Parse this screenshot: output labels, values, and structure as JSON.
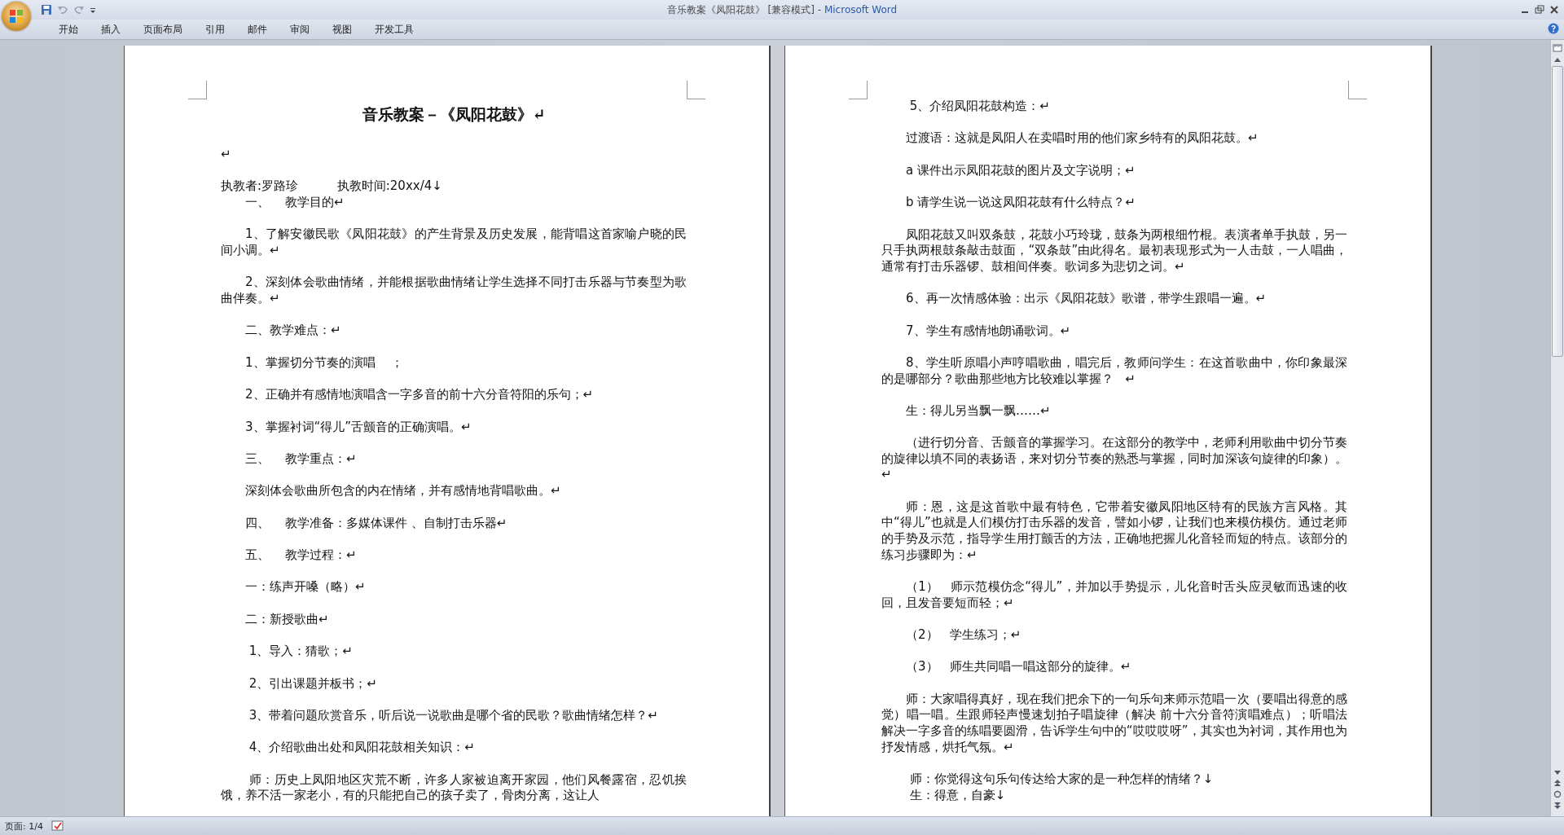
{
  "window": {
    "title_document": "音乐教案《凤阳花鼓》 [兼容模式] - ",
    "title_app": "Microsoft Word"
  },
  "ribbon_tabs": [
    {
      "label": "开始"
    },
    {
      "label": "插入"
    },
    {
      "label": "页面布局"
    },
    {
      "label": "引用"
    },
    {
      "label": "邮件"
    },
    {
      "label": "审阅"
    },
    {
      "label": "视图"
    },
    {
      "label": "开发工具"
    }
  ],
  "pages": [
    {
      "paragraphs": [
        {
          "kind": "title",
          "text": "音乐教案－《凤阳花鼓》↵"
        },
        {
          "kind": "mark",
          "text": "↵"
        },
        {
          "kind": "line",
          "text": "执教者:罗路珍          执教时间:20xx/4↓"
        },
        {
          "kind": "body",
          "text": "一、    教学目的↵"
        },
        {
          "kind": "body",
          "text": "1、了解安徽民歌《凤阳花鼓》的产生背景及历史发展，能背唱这首家喻户晓的民间小调。↵"
        },
        {
          "kind": "body",
          "text": "2、深刻体会歌曲情绪，并能根据歌曲情绪让学生选择不同打击乐器与节奏型为歌曲伴奏。↵"
        },
        {
          "kind": "body",
          "text": "二、教学难点：↵"
        },
        {
          "kind": "body",
          "text": "1、掌握切分节奏的演唱    ；"
        },
        {
          "kind": "body",
          "text": "2、正确并有感情地演唱含一字多音的前十六分音符阳的乐句；↵"
        },
        {
          "kind": "body",
          "text": "3、掌握衬词“得儿”舌颤音的正确演唱。↵"
        },
        {
          "kind": "body",
          "text": "三、    教学重点：↵"
        },
        {
          "kind": "body",
          "text": "深刻体会歌曲所包含的内在情绪，并有感情地背唱歌曲。↵"
        },
        {
          "kind": "body",
          "text": "四、    教学准备：多媒体课件 、自制打击乐器↵"
        },
        {
          "kind": "body",
          "text": "五、    教学过程：↵"
        },
        {
          "kind": "body",
          "text": "一：练声开嗓（略）↵"
        },
        {
          "kind": "body",
          "text": "二：新授歌曲↵"
        },
        {
          "kind": "body",
          "text": " 1、导入：猜歌；↵"
        },
        {
          "kind": "body",
          "text": " 2、引出课题并板书；↵"
        },
        {
          "kind": "body",
          "text": " 3、带着问题欣赏音乐，听后说一说歌曲是哪个省的民歌？歌曲情绪怎样？↵"
        },
        {
          "kind": "body",
          "text": " 4、介绍歌曲出处和凤阳花鼓相关知识：↵"
        },
        {
          "kind": "body",
          "text": " 师：历史上凤阳地区灾荒不断，许多人家被迫离开家园，他们风餐露宿，忍饥挨饿，养不活一家老小，有的只能把自己的孩子卖了，骨肉分离，这让人"
        }
      ]
    },
    {
      "paragraphs": [
        {
          "kind": "body",
          "text": " 5、介绍凤阳花鼓构造：↵"
        },
        {
          "kind": "body",
          "text": "过渡语：这就是凤阳人在卖唱时用的他们家乡特有的凤阳花鼓。↵"
        },
        {
          "kind": "body",
          "text": "a 课件出示凤阳花鼓的图片及文字说明；↵"
        },
        {
          "kind": "body",
          "text": "b 请学生说一说这凤阳花鼓有什么特点？↵"
        },
        {
          "kind": "body",
          "text": "凤阳花鼓又叫双条鼓，花鼓小巧玲珑，鼓条为两根细竹棍。表演者单手执鼓，另一只手执两根鼓条敲击鼓面，“双条鼓”由此得名。最初表现形式为一人击鼓，一人唱曲，通常有打击乐器锣、鼓相间伴奏。歌词多为悲切之词。↵"
        },
        {
          "kind": "body",
          "text": "6、再一次情感体验：出示《凤阳花鼓》歌谱，带学生跟唱一遍。↵"
        },
        {
          "kind": "body",
          "text": "7、学生有感情地朗诵歌词。↵"
        },
        {
          "kind": "body",
          "text": "8、学生听原唱小声哼唱歌曲，唱完后，教师问学生：在这首歌曲中，你印象最深的是哪部分？歌曲那些地方比较难以掌握？   ↵"
        },
        {
          "kind": "body",
          "text": "生：得儿另当飘一飘……↵"
        },
        {
          "kind": "body",
          "text": "（进行切分音、舌颤音的掌握学习。在这部分的教学中，老师利用歌曲中切分节奏的旋律以填不同的表扬语，来对切分节奏的熟悉与掌握，同时加深该句旋律的印象）。↵"
        },
        {
          "kind": "body",
          "text": "师：恩，这是这首歌中最有特色，它带着安徽凤阳地区特有的民族方言风格。其中“得儿”也就是人们模仿打击乐器的发音，譬如小锣，让我们也来模仿模仿。通过老师的手势及示范，指导学生用打颤舌的方法，正确地把握儿化音轻而短的特点。该部分的练习步骤即为：↵"
        },
        {
          "kind": "body",
          "text": "（1）   师示范模仿念“得儿”，并加以手势提示，儿化音时舌头应灵敏而迅速的收回，且发音要短而轻；↵"
        },
        {
          "kind": "body",
          "text": "（2）   学生练习；↵"
        },
        {
          "kind": "body",
          "text": "（3）   师生共同唱一唱这部分的旋律。↵"
        },
        {
          "kind": "body",
          "text": "师：大家唱得真好，现在我们把余下的一句乐句来师示范唱一次（要唱出得意的感觉）唱一唱。生跟师轻声慢速划拍子唱旋律（解决 前十六分音符演唱难点）；听唱法解决一字多音的练唱要圆滑，告诉学生句中的“哎哎哎呀”，其实也为衬词，其作用也为抒发情感，烘托气氛。↵"
        },
        {
          "kind": "indented-line",
          "text": " 师：你觉得这句乐句传达给大家的是一种怎样的情绪？↓"
        },
        {
          "kind": "indented-line",
          "text": " 生：得意，自豪↓"
        }
      ]
    }
  ],
  "status_bar": {
    "page": "页面: 1/4"
  }
}
